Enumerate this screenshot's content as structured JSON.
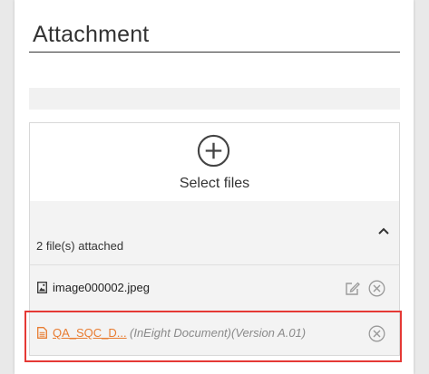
{
  "section": {
    "title": "Attachment"
  },
  "upload": {
    "select_label": "Select files"
  },
  "attachments": {
    "count_label": "2 file(s) attached",
    "files": [
      {
        "name": "image000002.jpeg",
        "icon": "image-file-icon"
      },
      {
        "name": "QA_SQC_D...",
        "meta": "(InEight Document)(Version A.01)",
        "icon": "document-file-icon"
      }
    ]
  },
  "colors": {
    "link": "#e87c31",
    "highlight": "#e53935",
    "icon_gray": "#9a9a9a"
  }
}
